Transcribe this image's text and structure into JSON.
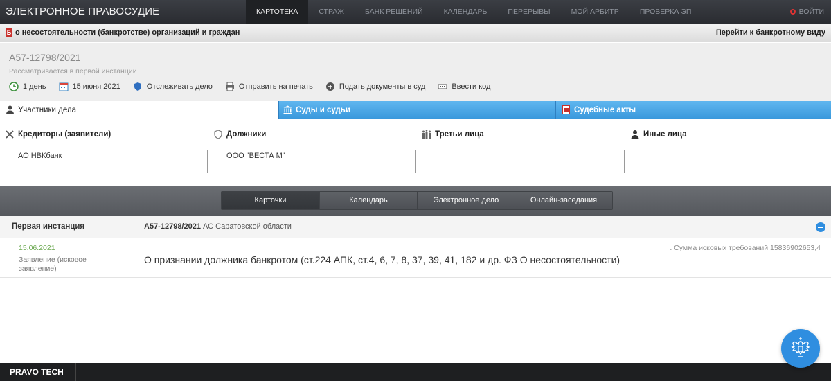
{
  "topbar": {
    "brand": "ЭЛЕКТРОННОЕ ПРАВОСУДИЕ",
    "nav": [
      "КАРТОТЕКА",
      "СТРАЖ",
      "БАНК РЕШЕНИЙ",
      "КАЛЕНДАРЬ",
      "ПЕРЕРЫВЫ",
      "МОЙ АРБИТР",
      "ПРОВЕРКА ЭП"
    ],
    "active_nav": "КАРТОТЕКА",
    "logout": "ВОЙТИ"
  },
  "category": {
    "badge": "Б",
    "title": "о несостоятельности (банкротстве) организаций и граждан",
    "link": "Перейти к банкротному виду"
  },
  "case": {
    "number": "А57-12798/2021",
    "status": "Рассматривается в первой инстанции",
    "actions": [
      {
        "label": "1 день",
        "icon": "clock-back-icon"
      },
      {
        "label": "15 июня 2021",
        "icon": "calendar-icon"
      },
      {
        "label": "Отслеживать дело",
        "icon": "shield-icon"
      },
      {
        "label": "Отправить на печать",
        "icon": "printer-icon"
      },
      {
        "label": "Подать документы в суд",
        "icon": "plus-circle-icon"
      },
      {
        "label": "Ввести код",
        "icon": "keyboard-icon"
      }
    ]
  },
  "tabs": [
    {
      "label": "Участники дела",
      "icon": "person-icon"
    },
    {
      "label": "Суды и судьи",
      "icon": "court-building-icon"
    },
    {
      "label": "Судебные акты",
      "icon": "pdf-icon"
    }
  ],
  "participants": [
    {
      "header": "Кредиторы (заявители)",
      "icon": "crossed-swords-icon",
      "value": "АО НВКбанк"
    },
    {
      "header": "Должники",
      "icon": "shield-icon",
      "value": "ООО \"ВЕСТА М\""
    },
    {
      "header": "Третьи лица",
      "icon": "people-group-icon",
      "value": ""
    },
    {
      "header": "Иные лица",
      "icon": "person-icon",
      "value": ""
    }
  ],
  "segments": [
    "Карточки",
    "Календарь",
    "Электронное дело",
    "Онлайн-заседания"
  ],
  "instance": {
    "label": "Первая инстанция",
    "case_number": "А57-12798/2021",
    "court": "АС Саратовской области"
  },
  "document": {
    "date": "15.06.2021",
    "type": "Заявление (исковое заявление)",
    "description": "О признании должника банкротом (ст.224 АПК, ст.4, 6, 7, 8, 37, 39, 41, 182 и др. ФЗ О несостоятельности)",
    "claim_sum": ". Сумма исковых требований 15836902653,4"
  },
  "footer": {
    "brand": "PRAVO TECH"
  },
  "colors": {
    "accent_blue": "#3998dc",
    "date_green": "#6aa84f",
    "alert_red": "#c8302c"
  }
}
